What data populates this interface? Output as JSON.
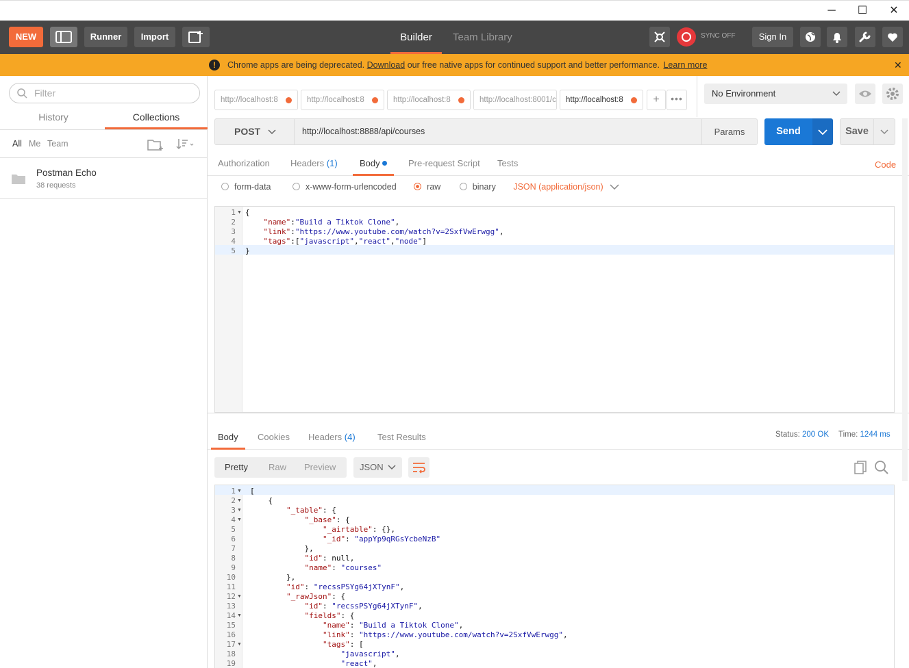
{
  "window": {
    "minimize": "─",
    "maximize": "☐",
    "close": "✕"
  },
  "topbar": {
    "new_label": "NEW",
    "runner_label": "Runner",
    "import_label": "Import",
    "builder_tab": "Builder",
    "team_library_tab": "Team Library",
    "sync_label": "SYNC OFF",
    "signin_label": "Sign In"
  },
  "banner": {
    "pre": "Chrome apps are being deprecated.",
    "link1": "Download",
    "mid": "our free native apps for continued support and better performance.",
    "link2": "Learn more",
    "close": "✕"
  },
  "sidebar": {
    "filter_placeholder": "Filter",
    "tabs": [
      "History",
      "Collections"
    ],
    "filters": [
      "All",
      "Me",
      "Team"
    ],
    "collection": {
      "name": "Postman Echo",
      "count": "38 requests"
    }
  },
  "request_tabs": [
    "http://localhost:8",
    "http://localhost:8",
    "http://localhost:8",
    "http://localhost:8001/c",
    "http://localhost:8"
  ],
  "environment": {
    "selected": "No Environment"
  },
  "request": {
    "method": "POST",
    "url": "http://localhost:8888/api/courses",
    "params_label": "Params",
    "send_label": "Send",
    "save_label": "Save"
  },
  "req_tabs": {
    "authorization": "Authorization",
    "headers": "Headers",
    "headers_count": "(1)",
    "body": "Body",
    "prerequest": "Pre-request Script",
    "tests": "Tests",
    "code": "Code"
  },
  "body_types": {
    "formdata": "form-data",
    "urlencoded": "x-www-form-urlencoded",
    "raw": "raw",
    "binary": "binary",
    "content_type": "JSON (application/json)"
  },
  "request_body_lines": [
    "{",
    "    \"name\":\"Build a Tiktok Clone\",",
    "    \"link\":\"https://www.youtube.com/watch?v=2SxfVwErwgg\",",
    "    \"tags\":[\"javascript\",\"react\",\"node\"]",
    "}"
  ],
  "response": {
    "tabs": {
      "body": "Body",
      "cookies": "Cookies",
      "headers": "Headers",
      "headers_count": "(4)",
      "tests": "Test Results"
    },
    "status_label": "Status:",
    "status_value": "200 OK",
    "time_label": "Time:",
    "time_value": "1244 ms",
    "view_modes": [
      "Pretty",
      "Raw",
      "Preview"
    ],
    "format": "JSON",
    "lines": [
      "[",
      "    {",
      "        \"_table\": {",
      "            \"_base\": {",
      "                \"_airtable\": {},",
      "                \"_id\": \"appYp9qRGsYcbeNzB\"",
      "            },",
      "            \"id\": null,",
      "            \"name\": \"courses\"",
      "        },",
      "        \"id\": \"recssPSYg64jXTynF\",",
      "        \"_rawJson\": {",
      "            \"id\": \"recssPSYg64jXTynF\",",
      "            \"fields\": {",
      "                \"name\": \"Build a Tiktok Clone\",",
      "                \"link\": \"https://www.youtube.com/watch?v=2SxfVwErwgg\",",
      "                \"tags\": [",
      "                    \"javascript\",",
      "                    \"react\","
    ]
  },
  "colors": {
    "accent": "#f26b3a",
    "send": "#1a78d6",
    "banner": "#f6a623",
    "topbar": "#464646"
  }
}
